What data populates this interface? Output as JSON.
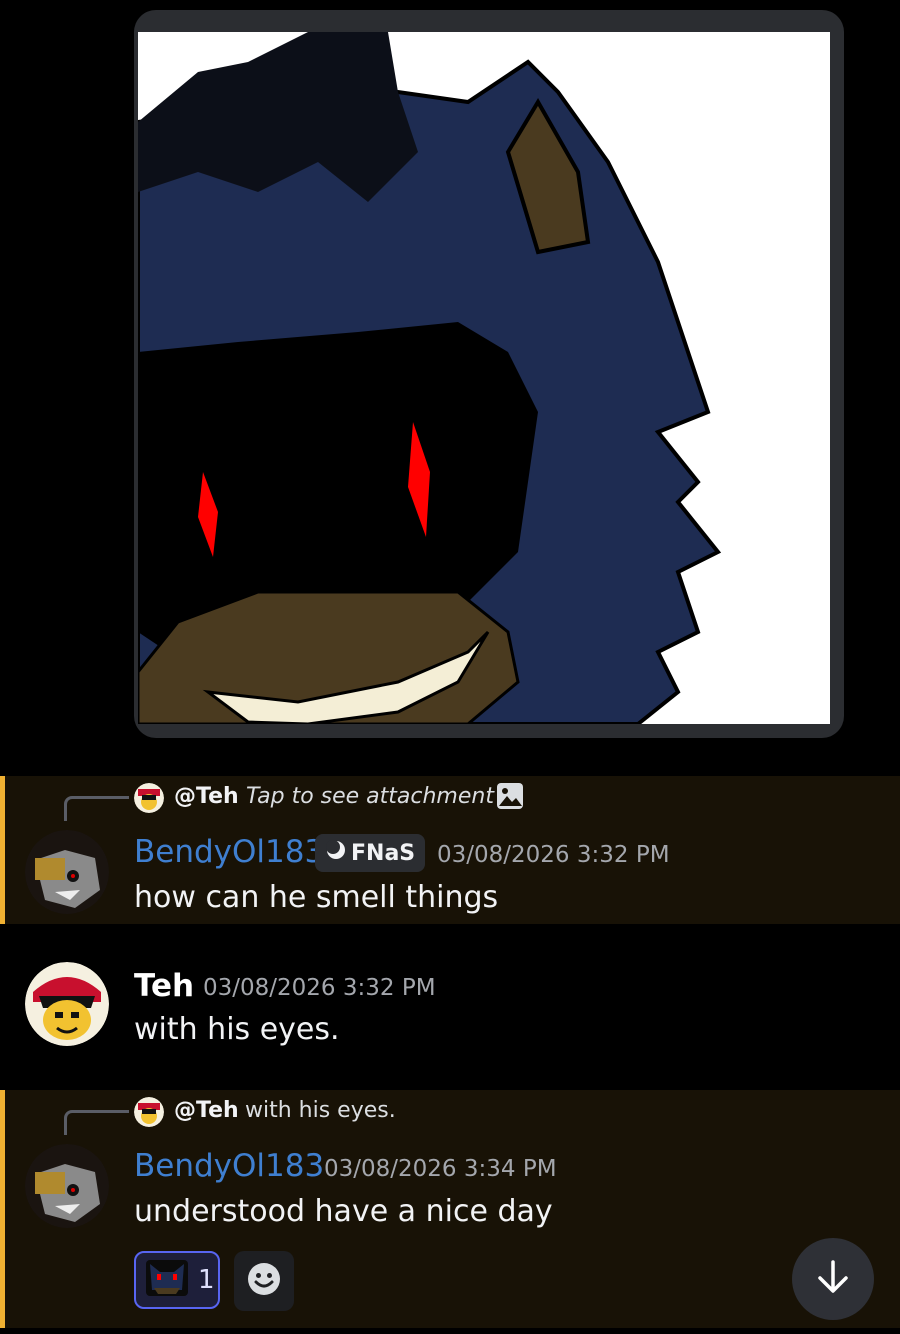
{
  "attachment": {
    "alt": "dark hedgehog drawing",
    "icon": "image-attachment"
  },
  "messages": [
    {
      "reply": {
        "name": "@Teh",
        "text": "Tap to see attachment",
        "icon": "image-icon"
      },
      "username": "BendyOl183",
      "tag": {
        "icon": "moon-icon",
        "label": "FNaS"
      },
      "timestamp": "03/08/2026 3:32 PM",
      "content": "how can he smell things"
    },
    {
      "username": "Teh",
      "timestamp": "03/08/2026 3:32 PM",
      "content": "with his eyes."
    },
    {
      "reply": {
        "name": "@Teh",
        "text": "with his eyes."
      },
      "username": "BendyOl183",
      "timestamp": "03/08/2026 3:34 PM",
      "content": "understood have a nice day",
      "reaction": {
        "emoji": "custom-emoji",
        "count": "1"
      }
    }
  ],
  "controls": {
    "add_reaction_icon": "smiley-icon",
    "scroll_icon": "arrow-down-icon"
  },
  "colors": {
    "accent_bar": "#f0b132",
    "username_blue": "#3f7fd0",
    "reaction_border": "#5865f2"
  }
}
